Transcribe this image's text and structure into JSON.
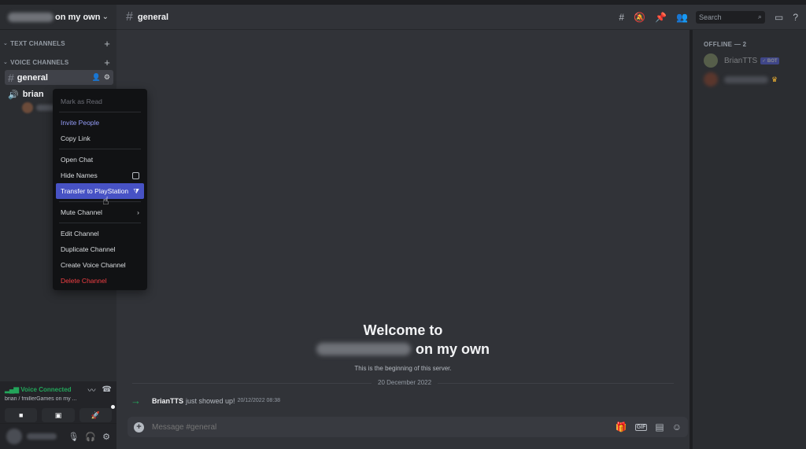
{
  "server": {
    "name_suffix": "on my own"
  },
  "sidebar": {
    "text_category": "TEXT CHANNELS",
    "voice_category": "VOICE CHANNELS",
    "channels": [
      {
        "label": "general"
      },
      {
        "label": "brian"
      }
    ]
  },
  "voice_panel": {
    "status": "Voice Connected",
    "subtitle": "brian / fmillerGames on my ..."
  },
  "header": {
    "channel": "general",
    "search_placeholder": "Search"
  },
  "welcome": {
    "title": "Welcome to",
    "line2_suffix": "on my own",
    "subtitle": "This is the beginning of this server."
  },
  "divider_date": "20 December 2022",
  "message": {
    "author": "BrianTTS",
    "text": "just showed up!",
    "timestamp": "20/12/2022 08:38"
  },
  "composer": {
    "placeholder": "Message #general"
  },
  "members": {
    "heading": "OFFLINE — 2",
    "items": [
      {
        "name": "BrianTTS",
        "badge": "✓ BOT"
      }
    ]
  },
  "context_menu": {
    "items": [
      "Mark as Read",
      "Invite People",
      "Copy Link",
      "Open Chat",
      "Hide Names",
      "Transfer to PlayStation",
      "Mute Channel",
      "Edit Channel",
      "Duplicate Channel",
      "Create Voice Channel",
      "Delete Channel"
    ]
  },
  "colors": {
    "accent": "#5865f2",
    "highlight": "#4752c4",
    "voice_green": "#23a55a",
    "danger": "#f23f43"
  }
}
